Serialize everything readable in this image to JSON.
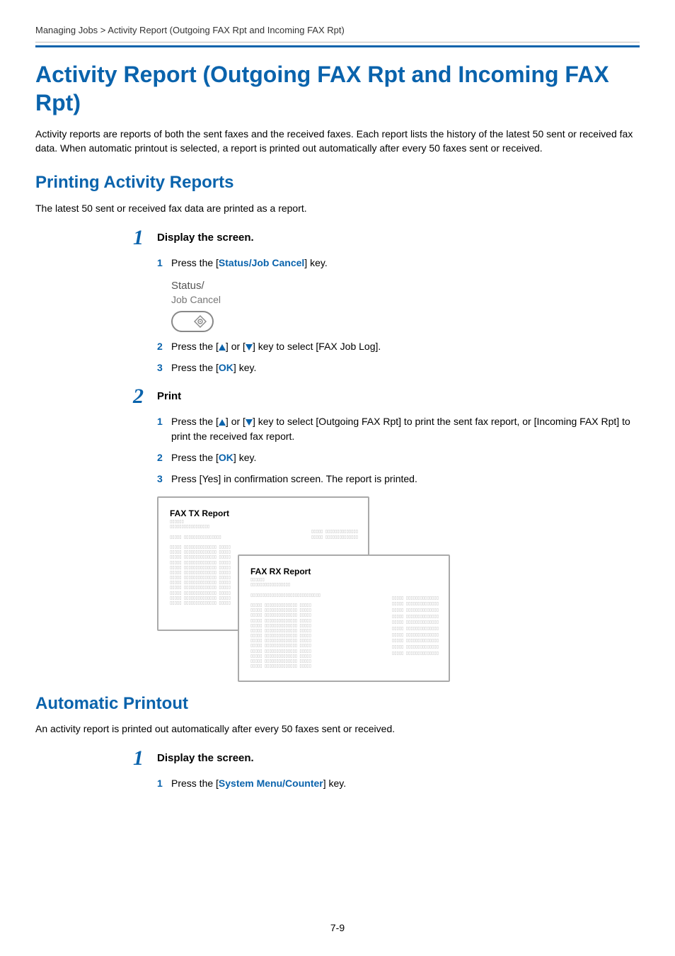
{
  "breadcrumb": "Managing Jobs > Activity Report (Outgoing FAX Rpt and Incoming FAX Rpt)",
  "main_heading": "Activity Report (Outgoing FAX Rpt and Incoming FAX Rpt)",
  "intro": "Activity reports are reports of both the sent faxes and the received faxes. Each report lists the history of the latest 50 sent or received fax data. When automatic printout is selected, a report is printed out automatically after every 50 faxes sent or received.",
  "s1": {
    "heading": "Printing Activity Reports",
    "sub": "The latest 50 sent or received fax data are printed as a report.",
    "step1": {
      "num": "1",
      "title": "Display the screen.",
      "i1": {
        "n": "1",
        "pre": "Press the [",
        "key": "Status/Job Cancel",
        "post": "] key."
      },
      "btn_label1": "Status/",
      "btn_label2": "Job Cancel",
      "i2": {
        "n": "2",
        "pre": "Press the [",
        "mid": "] or [",
        "post": "] key to select [FAX Job Log]."
      },
      "i3": {
        "n": "3",
        "pre": "Press the [",
        "key": "OK",
        "post": "] key."
      }
    },
    "step2": {
      "num": "2",
      "title": "Print",
      "i1": {
        "n": "1",
        "pre": "Press the [",
        "mid": "] or [",
        "post": "] key to select [Outgoing FAX Rpt] to print the sent fax report, or [Incoming FAX Rpt] to print the received fax report."
      },
      "i2": {
        "n": "2",
        "pre": "Press the [",
        "key": "OK",
        "post": "] key."
      },
      "i3": {
        "n": "3",
        "text": "Press [Yes] in confirmation screen. The report is printed."
      }
    },
    "figure": {
      "tx_title": "FAX TX Report",
      "rx_title": "FAX RX Report"
    }
  },
  "s2": {
    "heading": "Automatic Printout",
    "sub": "An activity report is printed out automatically after every 50 faxes sent or received.",
    "step1": {
      "num": "1",
      "title": "Display the screen.",
      "i1": {
        "n": "1",
        "pre": "Press the [",
        "key": "System Menu/Counter",
        "post": "] key."
      }
    }
  },
  "page_number": "7-9"
}
